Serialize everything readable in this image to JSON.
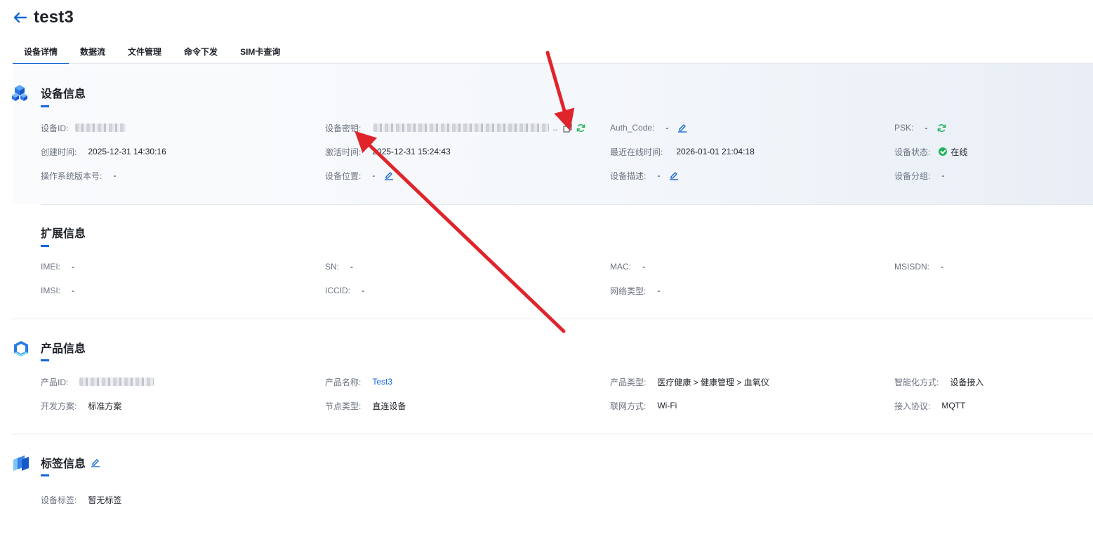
{
  "header": {
    "title": "test3"
  },
  "tabs": [
    {
      "label": "设备详情",
      "active": true
    },
    {
      "label": "数据流"
    },
    {
      "label": "文件管理"
    },
    {
      "label": "命令下发"
    },
    {
      "label": "SIM卡查询"
    }
  ],
  "device_info": {
    "title": "设备信息",
    "device_id": {
      "label": "设备ID:",
      "value": ""
    },
    "device_secret": {
      "label": "设备密钥:",
      "value": "",
      "ellipsis": ".."
    },
    "auth_code": {
      "label": "Auth_Code:",
      "value": "-"
    },
    "psk": {
      "label": "PSK:",
      "value": "-"
    },
    "created_time": {
      "label": "创建时间:",
      "value": "2025-12-31 14:30:16"
    },
    "activated_time": {
      "label": "激活时间:",
      "value": "2025-12-31 15:24:43"
    },
    "last_online": {
      "label": "最近在线时间:",
      "value": "2026-01-01 21:04:18"
    },
    "status": {
      "label": "设备状态:",
      "value": "在线"
    },
    "os_version": {
      "label": "操作系统版本号:",
      "value": "-"
    },
    "location": {
      "label": "设备位置:",
      "value": "-"
    },
    "description": {
      "label": "设备描述:",
      "value": "-"
    },
    "group": {
      "label": "设备分组:",
      "value": "-"
    }
  },
  "ext_info": {
    "title": "扩展信息",
    "imei": {
      "label": "IMEI:",
      "value": "-"
    },
    "sn": {
      "label": "SN:",
      "value": "-"
    },
    "mac": {
      "label": "MAC:",
      "value": "-"
    },
    "msisdn": {
      "label": "MSISDN:",
      "value": "-"
    },
    "imsi": {
      "label": "IMSI:",
      "value": "-"
    },
    "iccid": {
      "label": "ICCID:",
      "value": "-"
    },
    "network_type": {
      "label": "网络类型:",
      "value": "-"
    }
  },
  "product_info": {
    "title": "产品信息",
    "product_id": {
      "label": "产品ID:",
      "value": ""
    },
    "product_name": {
      "label": "产品名称:",
      "value": "Test3"
    },
    "product_type": {
      "label": "产品类型:",
      "value": "医疗健康 > 健康管理 > 血氧仪"
    },
    "smart_mode": {
      "label": "智能化方式:",
      "value": "设备接入"
    },
    "dev_plan": {
      "label": "开发方案:",
      "value": "标准方案"
    },
    "node_type": {
      "label": "节点类型:",
      "value": "直连设备"
    },
    "network_mode": {
      "label": "联网方式:",
      "value": "Wi-Fi"
    },
    "protocol": {
      "label": "接入协议:",
      "value": "MQTT"
    }
  },
  "tag_info": {
    "title": "标签信息",
    "tags": {
      "label": "设备标签:",
      "value": "暂无标签"
    }
  },
  "colors": {
    "accent": "#1665d8",
    "online": "#21b35c",
    "arrow": "#e0242b"
  },
  "icons": [
    "back-arrow-icon",
    "cube-cluster-icon",
    "product-box-icon",
    "tag-stack-icon",
    "copy-icon",
    "refresh-icon",
    "edit-icon"
  ]
}
